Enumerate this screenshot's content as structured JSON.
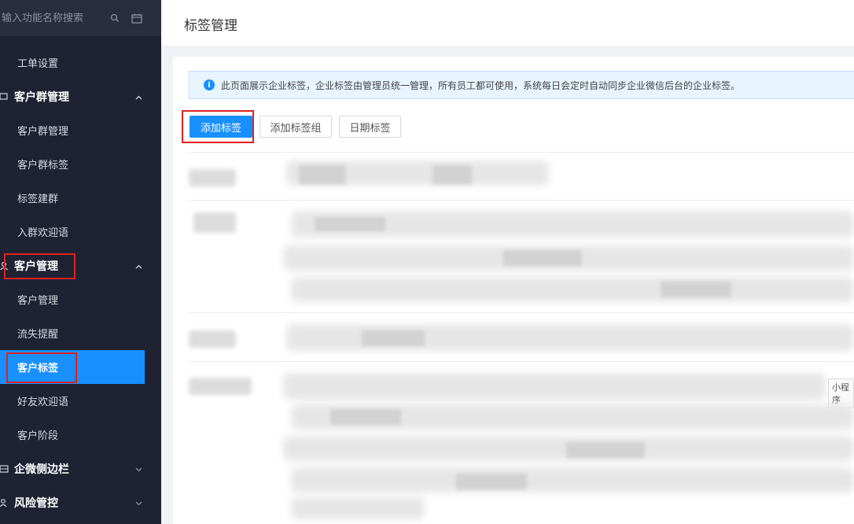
{
  "sidebar": {
    "search_placeholder": "输入功能名称搜索",
    "items": [
      {
        "label": "工单设置",
        "type": "item"
      },
      {
        "label": "客户群管理",
        "type": "group",
        "expanded": true
      },
      {
        "label": "客户群管理",
        "type": "item"
      },
      {
        "label": "客户群标签",
        "type": "item"
      },
      {
        "label": "标签建群",
        "type": "item"
      },
      {
        "label": "入群欢迎语",
        "type": "item"
      },
      {
        "label": "客户管理",
        "type": "group",
        "expanded": true
      },
      {
        "label": "客户管理",
        "type": "item"
      },
      {
        "label": "流失提醒",
        "type": "item"
      },
      {
        "label": "客户标签",
        "type": "item",
        "active": true
      },
      {
        "label": "好友欢迎语",
        "type": "item"
      },
      {
        "label": "客户阶段",
        "type": "item"
      },
      {
        "label": "企微侧边栏",
        "type": "group",
        "expanded": false
      },
      {
        "label": "风险管控",
        "type": "group",
        "expanded": false
      }
    ]
  },
  "header": {
    "title": "标签管理"
  },
  "notice": {
    "text": "此页面展示企业标签，企业标签由管理员统一管理，所有员工都可使用，系统每日会定时自动同步企业微信后台的企业标签。",
    "icon": "i"
  },
  "toolbar": {
    "add_tag": "添加标签",
    "add_tag_group": "添加标签组",
    "date_tag": "日期标签"
  },
  "visible_tag_fragments": [
    "小程序"
  ],
  "colors": {
    "accent": "#1890ff",
    "sidebar_bg": "#1f2233",
    "highlight": "#e02020"
  }
}
